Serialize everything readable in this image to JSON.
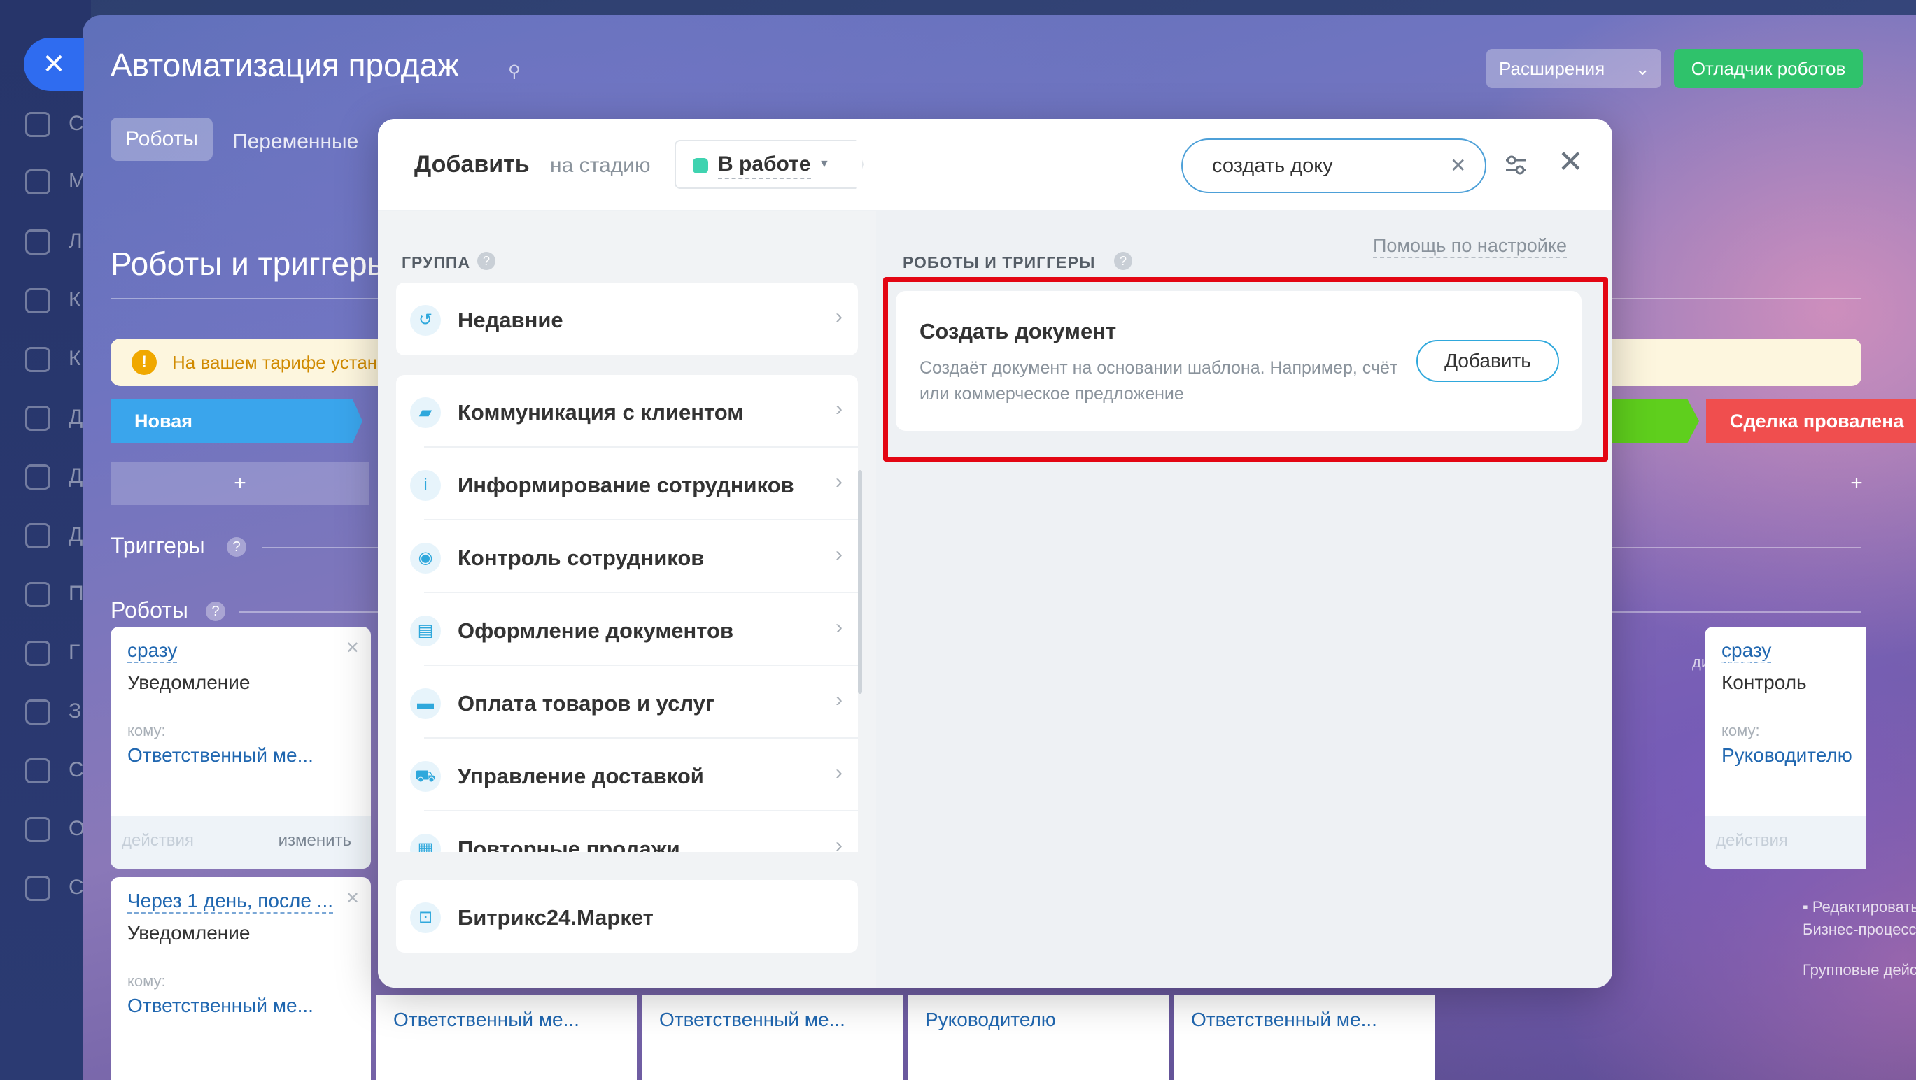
{
  "rail": {
    "labels": [
      "С",
      "М",
      "Л",
      "К",
      "К",
      "Д",
      "Д",
      "Д",
      "П",
      "Г",
      "З",
      "С",
      "О",
      "С"
    ]
  },
  "slider": {
    "title": "Автоматизация продаж",
    "tabs": [
      "Роботы",
      "Переменные"
    ],
    "extensions_label": "Расширения",
    "debugger_label": "Отладчик роботов",
    "section_title": "Роботы и триггеры",
    "tariff_text": "На вашем тарифе установлено ограничение",
    "stages": {
      "new": "Новая",
      "lost": "Сделка провалена"
    },
    "add_symbol": "+",
    "triggers_label": "Триггеры",
    "robots_label": "Роботы",
    "cards": [
      {
        "when": "сразу",
        "type": "Уведомление",
        "to_label": "кому:",
        "to": "Ответственный ме...",
        "foot_a": "действия",
        "foot_b": "изменить"
      },
      {
        "when": "Через 1 день, после ...",
        "type": "Уведомление",
        "to_label": "кому:",
        "to": "Ответственный ме..."
      },
      {
        "when": "сразу",
        "type": "Контроль",
        "to_label": "кому:",
        "to": "Руководителю",
        "foot_a": "действия"
      }
    ],
    "bottom_values": [
      "Ответственный ме...",
      "Ответственный ме...",
      "Руководителю",
      "Ответственный ме..."
    ],
    "designer_text": "дизайнере",
    "right_links": [
      "Редактировать в",
      "Бизнес-процессов",
      "Групповые действ"
    ]
  },
  "modal": {
    "title": "Добавить",
    "stage_label": "на стадию",
    "stage_value": "В работе",
    "search_value": "создать доку",
    "group_header": "ГРУППА",
    "results_header": "РОБОТЫ И ТРИГГЕРЫ",
    "help_link": "Помощь по настройке",
    "groups": [
      {
        "label": "Недавние",
        "icon": "history-icon"
      },
      {
        "label": "Коммуникация с клиентом",
        "icon": "chat-icon"
      },
      {
        "label": "Информирование сотрудников",
        "icon": "info-icon"
      },
      {
        "label": "Контроль сотрудников",
        "icon": "people-icon"
      },
      {
        "label": "Оформление документов",
        "icon": "document-icon"
      },
      {
        "label": "Оплата товаров и услуг",
        "icon": "wallet-icon"
      },
      {
        "label": "Управление доставкой",
        "icon": "truck-icon"
      },
      {
        "label": "Повторные продажи",
        "icon": "cashbox-icon"
      },
      {
        "label": "Битрикс24.Маркет",
        "icon": "market-bag-icon"
      }
    ],
    "result": {
      "title": "Создать документ",
      "description": "Создаёт документ на основании шаблона. Например, счёт или коммерческое предложение",
      "button": "Добавить"
    },
    "highlight_color": "#e30613"
  }
}
